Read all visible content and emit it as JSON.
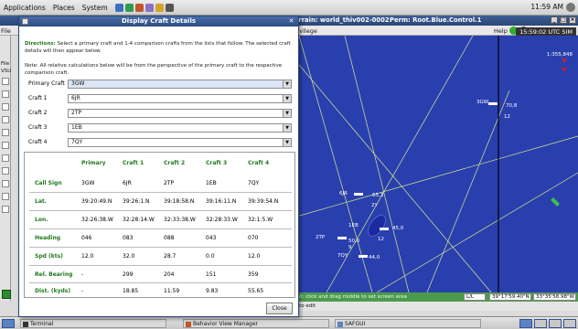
{
  "topbar": {
    "menus": [
      "Applications",
      "Places",
      "System"
    ],
    "clock": "11:59 AM"
  },
  "bgwindow": {
    "terrain": "Terrain: world_thiv002-0002",
    "perm": "Perm: Root.Blue.Control.1",
    "privilege_menu": "Privilege",
    "help_menu": "Help",
    "utc": "15:59:02 UTC SIM",
    "file_menu": "File",
    "side_label": "VSU",
    "status_hint": "oint: click and drag middle to set screen area",
    "status_hint2": "m to edit",
    "coord_mode": "L/L",
    "lat": "39°17'59.40\"N",
    "lon": "33°35'58.98\"W",
    "scale": "1:355,848"
  },
  "map": {
    "craft_labels": [
      {
        "id": "3GW",
        "extra": "70,8",
        "sub": "12"
      },
      {
        "id": "6JR",
        "extra": "65,3",
        "sub": "2Y"
      },
      {
        "id": "1EB",
        "extra": "45,0",
        "sub": "12"
      },
      {
        "id": "2TP",
        "extra": "50,0",
        "sub": "9"
      },
      {
        "id": "7QY",
        "extra": "44,0",
        "sub": ""
      }
    ],
    "colors": {
      "sea": "#2a3fae",
      "tracks": "#d8e890"
    }
  },
  "dialog": {
    "title": "Display Craft Details",
    "directions_label": "Directions:",
    "directions_text": "Select a primary craft and 1-4 comparison crafts from the lists that follow. The selected craft details will then appear below.",
    "note": "Note: All relative calculations below will be from the perspective of the primary craft to the respective comparison craft.",
    "selectors": [
      {
        "label": "Primary Craft",
        "value": "3GW"
      },
      {
        "label": "Craft 1",
        "value": "6JR"
      },
      {
        "label": "Craft 2",
        "value": "2TP"
      },
      {
        "label": "Craft 3",
        "value": "1EB"
      },
      {
        "label": "Craft 4",
        "value": "7QY"
      }
    ],
    "table": {
      "columns": [
        "Primary",
        "Craft 1",
        "Craft 2",
        "Craft 3",
        "Craft 4"
      ],
      "rows": [
        {
          "label": "Call Sign",
          "values": [
            "3GW",
            "6JR",
            "2TP",
            "1EB",
            "7QY"
          ]
        },
        {
          "label": "Lat.",
          "values": [
            "39:20:49.N",
            "39:26:1.N",
            "39:18:58.N",
            "39:16:11.N",
            "39:39:54.N"
          ]
        },
        {
          "label": "Lon.",
          "values": [
            "32:26:38.W",
            "32:28:14.W",
            "32:33:38.W",
            "32:28:33.W",
            "32:1:5.W"
          ]
        },
        {
          "label": "Heading",
          "values": [
            "046",
            "083",
            "088",
            "043",
            "070"
          ]
        },
        {
          "label": "Spd (kts)",
          "values": [
            "12.0",
            "32.0",
            "28.7",
            "0.0",
            "12.0"
          ]
        },
        {
          "label": "Rel. Bearing",
          "values": [
            "-",
            "299",
            "204",
            "151",
            "359"
          ]
        },
        {
          "label": "Dist. (kyds)",
          "values": [
            "-",
            "18.85",
            "11.59",
            "9.83",
            "55.65"
          ]
        }
      ]
    },
    "close_label": "Close"
  },
  "taskbar": {
    "tasks": [
      "Terminal",
      "Behavior View Manager",
      "SAFGUI"
    ]
  }
}
